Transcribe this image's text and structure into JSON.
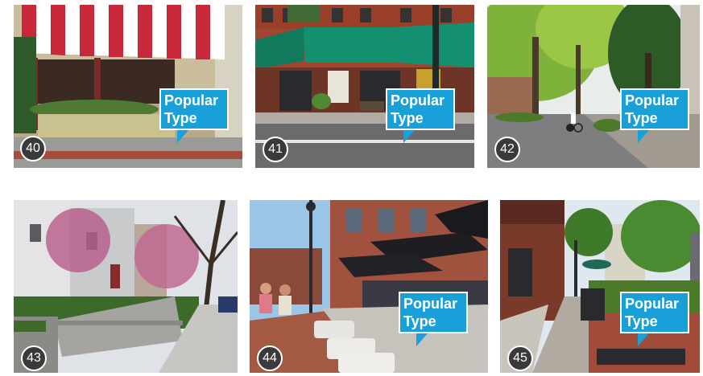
{
  "cards": [
    {
      "number": "40",
      "tag_line1": "Popular",
      "tag_line2": "Type"
    },
    {
      "number": "41",
      "tag_line1": "Popular",
      "tag_line2": "Type"
    },
    {
      "number": "42",
      "tag_line1": "Popular",
      "tag_line2": "Type"
    },
    {
      "number": "43"
    },
    {
      "number": "44",
      "tag_line1": "Popular",
      "tag_line2": "Type"
    },
    {
      "number": "45",
      "tag_line1": "Popular",
      "tag_line2": "Type"
    }
  ]
}
